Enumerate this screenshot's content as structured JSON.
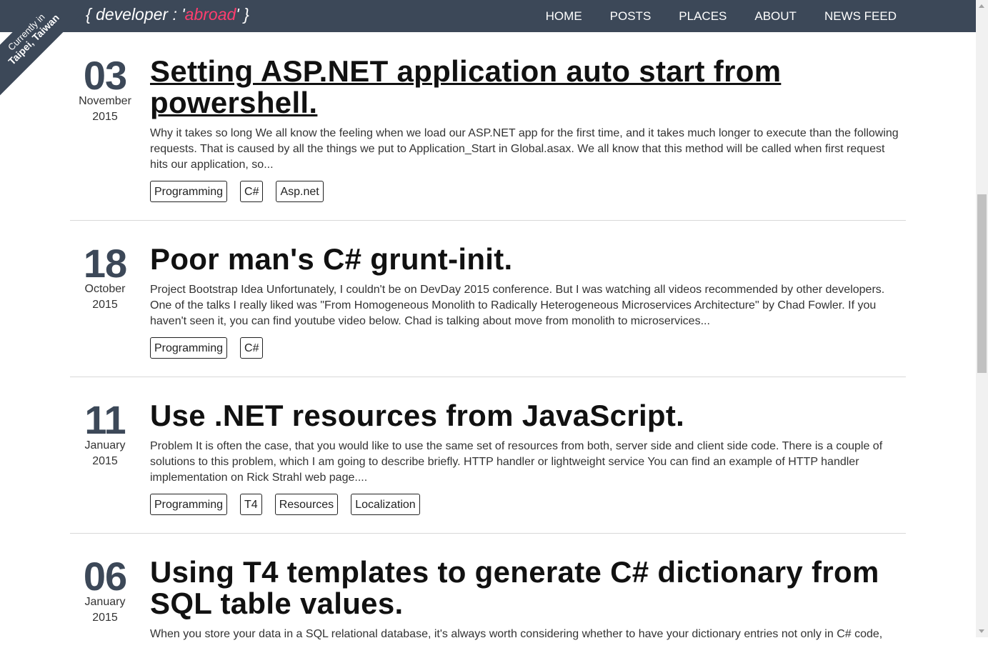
{
  "brand": {
    "prefix": "{ developer : '",
    "accent": "abroad",
    "suffix": "' }"
  },
  "ribbon": {
    "line1": "Currently in",
    "line2": "Taipei, Taiwan"
  },
  "nav": [
    "HOME",
    "POSTS",
    "PLACES",
    "ABOUT",
    "NEWS FEED"
  ],
  "posts": [
    {
      "day": "03",
      "month": "November",
      "year": "2015",
      "title": "Setting ASP.NET application auto start from powershell.",
      "excerpt": "Why it takes so long We all know the feeling when we load our ASP.NET app for the first time, and it takes much longer to execute than the following requests. That is caused by all the things we put to Application_Start in Global.asax. We all know that this method will be called when first request hits our application, so...",
      "tags": [
        "Programming",
        "C#",
        "Asp.net"
      ]
    },
    {
      "day": "18",
      "month": "October",
      "year": "2015",
      "title": "Poor man's C# grunt-init.",
      "excerpt": "Project Bootstrap Idea Unfortunately, I couldn't be on DevDay 2015 conference. But I was watching all videos recommended by other developers. One of the talks I really liked was \"From Homogeneous Monolith to Radically Heterogeneous Microservices Architecture\" by Chad Fowler. If you haven't seen it, you can find youtube video below. Chad is talking about move from monolith to microservices...",
      "tags": [
        "Programming",
        "C#"
      ]
    },
    {
      "day": "11",
      "month": "January",
      "year": "2015",
      "title": "Use .NET resources from JavaScript.",
      "excerpt": "Problem It is often the case, that you would like to use the same set of resources from both, server side and client side code. There is a couple of solutions to this problem, which I am going to describe briefly. HTTP handler or lightweight service You can find an example of HTTP handler implementation on Rick Strahl web page....",
      "tags": [
        "Programming",
        "T4",
        "Resources",
        "Localization"
      ]
    },
    {
      "day": "06",
      "month": "January",
      "year": "2015",
      "title": "Using T4 templates to generate C# dictionary from SQL table values.",
      "excerpt": "When you store your data in a SQL relational database, it's always worth considering whether to have your dictionary entries not only in C# code,",
      "tags": []
    }
  ]
}
